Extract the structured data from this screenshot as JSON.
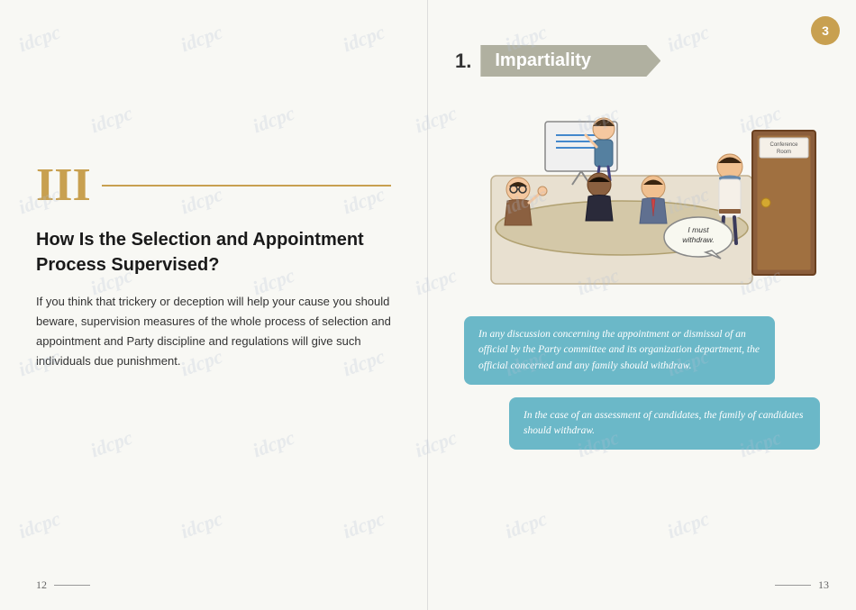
{
  "left_page": {
    "page_number": "12",
    "roman": "III",
    "heading": "How Is the Selection and Appointment\nProcess Supervised?",
    "body": "If you think that trickery or deception will help your cause you should beware, supervision measures of the whole process of selection and appointment and Party discipline and regulations will give such individuals due punishment."
  },
  "right_page": {
    "page_number": "13",
    "badge": "3",
    "section_number": "1.",
    "section_title": "Impartiality",
    "speech_bubble": "I must\nwithdraw.",
    "conference_room_label": "Conference\nRoom",
    "info_box_1": "In any discussion concerning the appointment or dismissal of an official by the Party committee and its organization department, the official concerned and any family should withdraw.",
    "info_box_2": "In the case of an assessment of candidates, the family of candidates should withdraw."
  },
  "watermark": "idcpc"
}
